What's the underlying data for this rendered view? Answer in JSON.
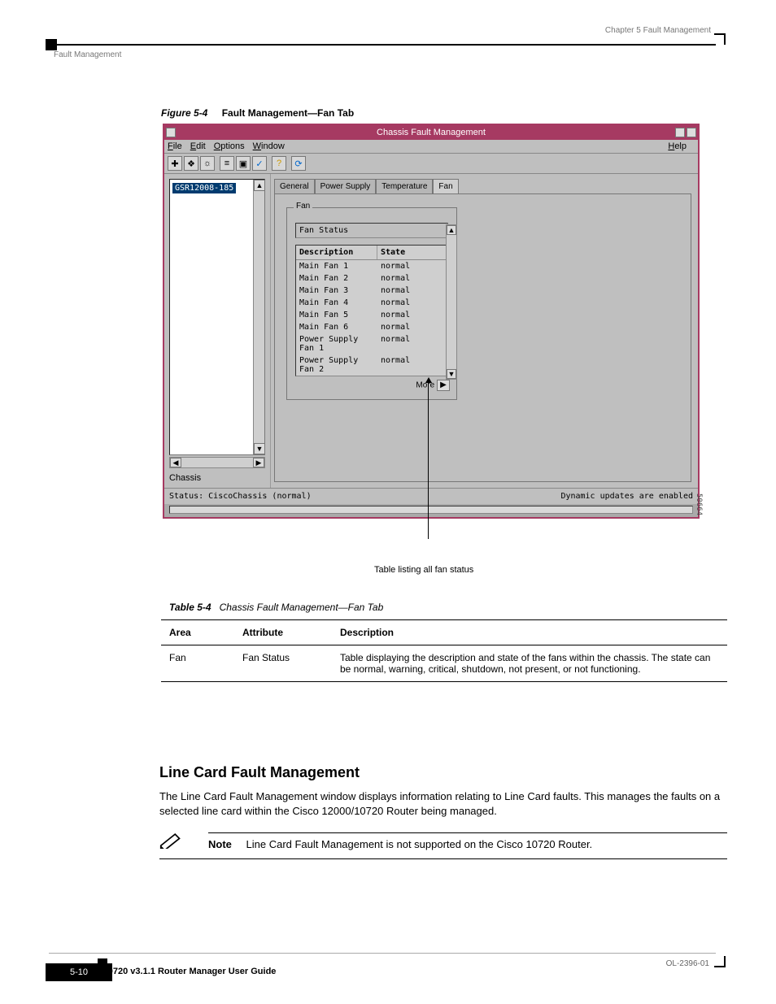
{
  "page_header": {
    "chapter": "Chapter 5      Fault Management",
    "section": "Fault Management"
  },
  "figure": {
    "number": "Figure 5-4",
    "caption": "Fault Management—Fan Tab"
  },
  "window": {
    "title": "Chassis Fault Management",
    "menu": {
      "file": "File",
      "edit": "Edit",
      "options": "Options",
      "window": "Window",
      "help": "Help"
    },
    "tree": {
      "selected": "GSR12008-185",
      "pane_label": "Chassis"
    },
    "tabs": {
      "general": "General",
      "power": "Power Supply",
      "temperature": "Temperature",
      "fan": "Fan"
    },
    "group": {
      "title": "Fan",
      "status_label": "Fan Status"
    },
    "table": {
      "col_desc": "Description",
      "col_state": "State",
      "rows": [
        {
          "desc": "Main Fan 1",
          "state": "normal"
        },
        {
          "desc": "Main Fan 2",
          "state": "normal"
        },
        {
          "desc": "Main Fan 3",
          "state": "normal"
        },
        {
          "desc": "Main Fan 4",
          "state": "normal"
        },
        {
          "desc": "Main Fan 5",
          "state": "normal"
        },
        {
          "desc": "Main Fan 6",
          "state": "normal"
        },
        {
          "desc": "Power Supply Fan 1",
          "state": "normal"
        },
        {
          "desc": "Power Supply Fan 2",
          "state": "normal"
        }
      ],
      "more": "More"
    },
    "status_left": "Status: CiscoChassis (normal)",
    "status_right": "Dynamic updates are enabled",
    "image_id": "50664"
  },
  "callout": "Table listing all fan status",
  "doc_table": {
    "title_left": "Table 5-4",
    "title_right": "Chassis Fault Management—Fan Tab",
    "area": "Area",
    "attribute": "Attribute",
    "description": "Description",
    "row_area": "Fan",
    "row_attr": "Fan Status",
    "row_desc": "Table displaying the description and state of the fans within the chassis. The state can be normal, warning, critical, shutdown, not present, or not functioning."
  },
  "section": {
    "heading": "Line Card Fault Management",
    "para": "The Line Card Fault Management window displays information relating to Line Card faults. This manages the faults on a selected line card within the Cisco 12000/10720 Router being managed.",
    "note_label": "Note",
    "note_text": "Line Card Fault Management is not supported on the Cisco 10720 Router."
  },
  "footer": {
    "book": "Cisco 12000/10720 v3.1.1 Router Manager User Guide",
    "doc_no": "OL-2396-01",
    "page": "5-10"
  }
}
